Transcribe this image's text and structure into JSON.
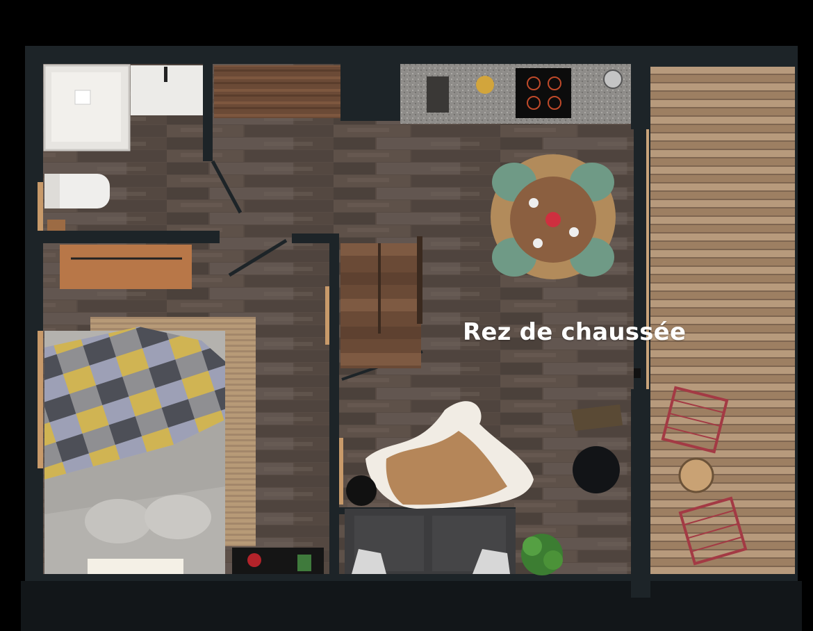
{
  "plan": {
    "floor_label": "Rez de chaussée",
    "rooms": [
      "bathroom",
      "kitchen",
      "dining-area",
      "bedroom",
      "living-room",
      "staircase",
      "terrace"
    ]
  },
  "colors": {
    "background": "#000000",
    "walls": "#1d2428",
    "wood-floor": "#574b44",
    "terrace-deck": "#a7896c",
    "chair-green": "#6f9a86",
    "terrace-chair-red": "#a33a44",
    "label": "#ffffff"
  }
}
